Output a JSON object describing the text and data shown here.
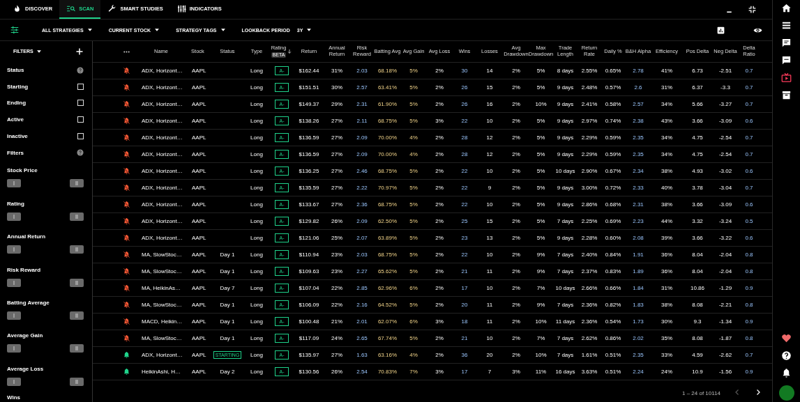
{
  "nav": {
    "tabs": [
      {
        "label": "DISCOVER",
        "selected": false
      },
      {
        "label": "SCAN",
        "selected": true
      },
      {
        "label": "SMART STUDIES",
        "selected": false
      },
      {
        "label": "INDICATORS",
        "selected": false
      }
    ]
  },
  "toolbar": {
    "dropdowns": [
      {
        "label": "ALL STRATEGIES"
      },
      {
        "label": "CURRENT STOCK"
      },
      {
        "label": "STRATEGY TAGS"
      },
      {
        "label": "LOOKBACK PERIOD",
        "value": "3Y"
      }
    ]
  },
  "sidebar": {
    "title": "FILTERS",
    "status_label": "Status",
    "checkboxes": [
      {
        "label": "Starting",
        "checked": false
      },
      {
        "label": "Ending",
        "checked": false
      },
      {
        "label": "Active",
        "checked": false
      },
      {
        "label": "Inactive",
        "checked": false
      }
    ],
    "filters_label": "Filters",
    "ranges": [
      "Stock Price",
      "Rating",
      "Annual Return",
      "Risk Reward",
      "Batting Average",
      "Average Gain",
      "Average Loss"
    ],
    "next_label": "Wins"
  },
  "table": {
    "columns": [
      "Name",
      "Stock",
      "Status",
      "Type",
      "Rating",
      "Return",
      "Annual Return",
      "Risk Reward",
      "Batting Avg",
      "Avg Gain",
      "Avg Loss",
      "Wins",
      "Losses",
      "Avg Drawdown",
      "Max Drawdown",
      "Trade Length",
      "Return Rate",
      "Daily %",
      "B&H Alpha",
      "Efficiency",
      "Pos Delta",
      "Neg Delta",
      "Delta Ratio"
    ],
    "rating_badge": "BETA",
    "rows": [
      {
        "alert": false,
        "name": "ADX, Horizont…",
        "stock": "AAPL",
        "type": "Long",
        "rating": "A-",
        "values": [
          "$162.44",
          "31%",
          "2.03",
          "68.18%",
          "5%",
          "2%",
          "30",
          "14",
          "2%",
          "5%",
          "8 days",
          "2.55%",
          "0.65%",
          "2.78",
          "41%",
          "6.73",
          "-2.51",
          "0.7"
        ]
      },
      {
        "alert": false,
        "name": "ADX, Horizont…",
        "stock": "AAPL",
        "type": "Long",
        "rating": "A-",
        "values": [
          "$151.51",
          "30%",
          "2.57",
          "63.41%",
          "5%",
          "2%",
          "26",
          "15",
          "2%",
          "5%",
          "9 days",
          "2.48%",
          "0.57%",
          "2.6",
          "31%",
          "6.37",
          "-3.3",
          "0.7"
        ]
      },
      {
        "alert": false,
        "name": "ADX, Horizont…",
        "stock": "AAPL",
        "type": "Long",
        "rating": "A-",
        "values": [
          "$149.37",
          "29%",
          "2.31",
          "61.90%",
          "5%",
          "2%",
          "26",
          "16",
          "2%",
          "10%",
          "9 days",
          "2.41%",
          "0.58%",
          "2.57",
          "34%",
          "5.66",
          "-3.27",
          "0.7"
        ]
      },
      {
        "alert": false,
        "name": "ADX, Horizont…",
        "stock": "AAPL",
        "type": "Long",
        "rating": "A-",
        "values": [
          "$138.26",
          "27%",
          "2.11",
          "68.75%",
          "5%",
          "3%",
          "22",
          "10",
          "2%",
          "5%",
          "9 days",
          "2.97%",
          "0.74%",
          "2.38",
          "43%",
          "3.66",
          "-3.09",
          "0.6"
        ]
      },
      {
        "alert": false,
        "name": "ADX, Horizont…",
        "stock": "AAPL",
        "type": "Long",
        "rating": "A-",
        "values": [
          "$136.59",
          "27%",
          "2.09",
          "70.00%",
          "4%",
          "2%",
          "28",
          "12",
          "2%",
          "5%",
          "9 days",
          "2.29%",
          "0.59%",
          "2.35",
          "34%",
          "4.75",
          "-2.54",
          "0.7"
        ]
      },
      {
        "alert": false,
        "name": "ADX, Horizont…",
        "stock": "AAPL",
        "type": "Long",
        "rating": "A-",
        "values": [
          "$136.59",
          "27%",
          "2.09",
          "70.00%",
          "4%",
          "2%",
          "28",
          "12",
          "2%",
          "5%",
          "9 days",
          "2.29%",
          "0.59%",
          "2.35",
          "34%",
          "4.75",
          "-2.54",
          "0.7"
        ]
      },
      {
        "alert": false,
        "name": "ADX, Horizont…",
        "stock": "AAPL",
        "type": "Long",
        "rating": "A-",
        "values": [
          "$136.25",
          "27%",
          "2.46",
          "68.75%",
          "5%",
          "2%",
          "22",
          "10",
          "2%",
          "5%",
          "10 days",
          "2.90%",
          "0.67%",
          "2.34",
          "38%",
          "4.93",
          "-3.02",
          "0.6"
        ]
      },
      {
        "alert": false,
        "name": "ADX, Horizont…",
        "stock": "AAPL",
        "type": "Long",
        "rating": "A-",
        "values": [
          "$135.59",
          "27%",
          "2.22",
          "70.97%",
          "5%",
          "2%",
          "22",
          "9",
          "2%",
          "5%",
          "9 days",
          "3.00%",
          "0.72%",
          "2.33",
          "40%",
          "3.78",
          "-3.04",
          "0.7"
        ]
      },
      {
        "alert": false,
        "name": "ADX, Horizont…",
        "stock": "AAPL",
        "type": "Long",
        "rating": "A-",
        "values": [
          "$133.67",
          "27%",
          "2.36",
          "68.75%",
          "5%",
          "2%",
          "22",
          "10",
          "2%",
          "5%",
          "9 days",
          "2.86%",
          "0.68%",
          "2.31",
          "38%",
          "3.66",
          "-3.09",
          "0.6"
        ]
      },
      {
        "alert": false,
        "name": "ADX, Horizont…",
        "stock": "AAPL",
        "type": "Long",
        "rating": "A-",
        "values": [
          "$129.82",
          "26%",
          "2.09",
          "62.50%",
          "5%",
          "2%",
          "25",
          "15",
          "2%",
          "5%",
          "7 days",
          "2.25%",
          "0.69%",
          "2.23",
          "44%",
          "3.32",
          "-3.24",
          "0.5"
        ]
      },
      {
        "alert": false,
        "name": "ADX, Horizont…",
        "stock": "AAPL",
        "type": "Long",
        "rating": "A-",
        "values": [
          "$121.06",
          "25%",
          "2.07",
          "63.89%",
          "5%",
          "2%",
          "23",
          "13",
          "2%",
          "5%",
          "9 days",
          "2.28%",
          "0.60%",
          "2.08",
          "39%",
          "3.66",
          "-3.22",
          "0.6"
        ]
      },
      {
        "alert": false,
        "name": "MA, SlowStoc…",
        "stock": "AAPL",
        "status": {
          "kind": "text",
          "label": "Day 1"
        },
        "type": "Long",
        "rating": "A-",
        "values": [
          "$110.94",
          "23%",
          "2.03",
          "68.75%",
          "5%",
          "2%",
          "22",
          "10",
          "2%",
          "9%",
          "7 days",
          "2.40%",
          "0.84%",
          "1.91",
          "36%",
          "8.04",
          "-2.04",
          "0.8"
        ]
      },
      {
        "alert": false,
        "name": "MA, SlowStoc…",
        "stock": "AAPL",
        "status": {
          "kind": "text",
          "label": "Day 1"
        },
        "type": "Long",
        "rating": "A-",
        "values": [
          "$109.63",
          "23%",
          "2.27",
          "65.62%",
          "5%",
          "2%",
          "21",
          "11",
          "2%",
          "9%",
          "7 days",
          "2.37%",
          "0.83%",
          "1.89",
          "36%",
          "8.04",
          "-2.04",
          "0.8"
        ]
      },
      {
        "alert": false,
        "name": "MA, HeikinAs…",
        "stock": "AAPL",
        "status": {
          "kind": "text",
          "label": "Day 7"
        },
        "type": "Long",
        "rating": "A-",
        "values": [
          "$107.04",
          "22%",
          "2.85",
          "62.96%",
          "6%",
          "2%",
          "17",
          "10",
          "2%",
          "7%",
          "10 days",
          "2.66%",
          "0.66%",
          "1.84",
          "31%",
          "10.86",
          "-1.29",
          "0.9"
        ]
      },
      {
        "alert": false,
        "name": "MA, SlowStoc…",
        "stock": "AAPL",
        "status": {
          "kind": "text",
          "label": "Day 1"
        },
        "type": "Long",
        "rating": "A-",
        "values": [
          "$106.09",
          "22%",
          "2.16",
          "64.52%",
          "5%",
          "2%",
          "20",
          "11",
          "2%",
          "9%",
          "7 days",
          "2.36%",
          "0.82%",
          "1.83",
          "38%",
          "8.08",
          "-2.21",
          "0.8"
        ]
      },
      {
        "alert": false,
        "name": "MACD, Heikin…",
        "stock": "AAPL",
        "status": {
          "kind": "text",
          "label": "Day 1"
        },
        "type": "Long",
        "rating": "A-",
        "values": [
          "$100.48",
          "21%",
          "2.01",
          "62.07%",
          "6%",
          "3%",
          "18",
          "11",
          "2%",
          "10%",
          "11 days",
          "2.36%",
          "0.54%",
          "1.73",
          "30%",
          "9.3",
          "-1.34",
          "0.9"
        ]
      },
      {
        "alert": false,
        "name": "MA, SlowStoc…",
        "stock": "AAPL",
        "status": {
          "kind": "text",
          "label": "Day 1"
        },
        "type": "Long",
        "rating": "A-",
        "values": [
          "$117.09",
          "24%",
          "2.65",
          "67.74%",
          "5%",
          "2%",
          "21",
          "10",
          "2%",
          "7%",
          "7 days",
          "2.62%",
          "0.86%",
          "2.02",
          "35%",
          "8.08",
          "-1.87",
          "0.8"
        ]
      },
      {
        "alert": true,
        "name": "ADX, Horizont…",
        "stock": "AAPL",
        "status": {
          "kind": "badge",
          "label": "STARTING"
        },
        "type": "Long",
        "rating": "A-",
        "values": [
          "$135.97",
          "27%",
          "1.63",
          "63.16%",
          "4%",
          "2%",
          "36",
          "20",
          "2%",
          "10%",
          "7 days",
          "1.61%",
          "0.51%",
          "2.35",
          "33%",
          "4.59",
          "-2.62",
          "0.7"
        ]
      },
      {
        "alert": true,
        "name": "HeikinAshi, H…",
        "stock": "AAPL",
        "status": {
          "kind": "text",
          "label": "Day 2"
        },
        "type": "Long",
        "rating": "A-",
        "values": [
          "$130.56",
          "26%",
          "2.54",
          "70.83%",
          "7%",
          "3%",
          "17",
          "7",
          "3%",
          "11%",
          "16 days",
          "3.63%",
          "0.51%",
          "2.24",
          "24%",
          "10.9",
          "-1.56",
          "0.9"
        ]
      }
    ]
  },
  "pagination": {
    "range": "1 – 24 of 10114",
    "prev_disabled": true
  }
}
